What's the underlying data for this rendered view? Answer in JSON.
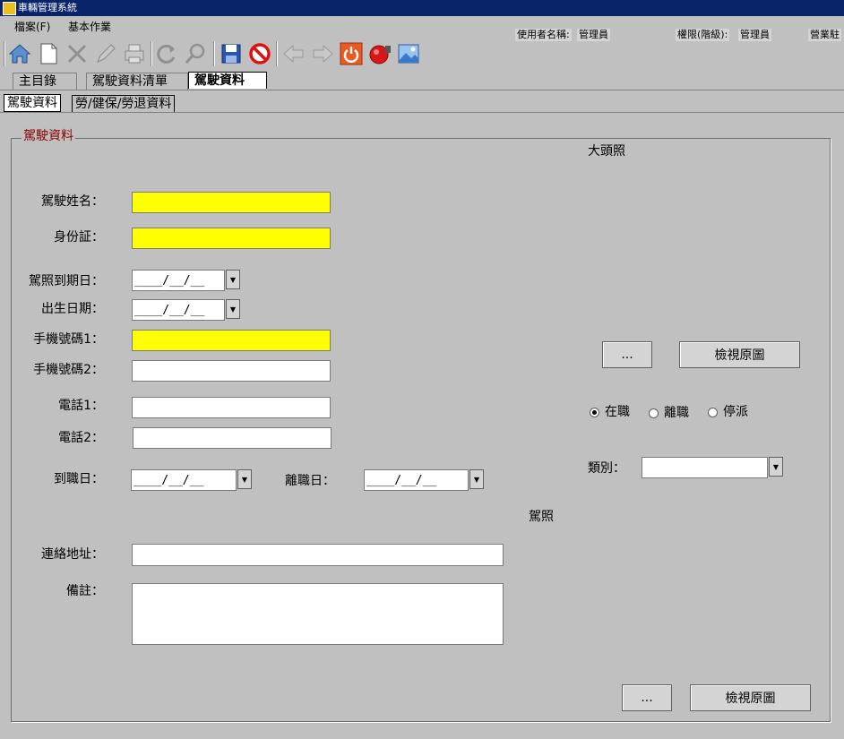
{
  "window": {
    "title": "車輛管理系統"
  },
  "menu": {
    "file": "檔案(F)",
    "basic": "基本作業"
  },
  "userinfo": {
    "user_label": "使用者名稱:",
    "user_value": "管理員",
    "role_label": "權限(階級):",
    "role_value": "管理員",
    "office_label": "營業駐"
  },
  "toolbar": {
    "icons": [
      "home-icon",
      "new-icon",
      "delete-icon",
      "edit-icon",
      "print-icon",
      "refresh-icon",
      "search-icon",
      "save-icon",
      "cancel-icon",
      "prev-icon",
      "next-icon",
      "power-icon",
      "alarm-icon",
      "image-icon"
    ]
  },
  "tabs": [
    {
      "label": "主目錄"
    },
    {
      "label": "駕駛資料清單"
    },
    {
      "label": "駕駛資料"
    }
  ],
  "subtabs": [
    {
      "label": "駕駛資料"
    },
    {
      "label": "勞/健保/勞退資料"
    }
  ],
  "form": {
    "group_title": "駕駛資料",
    "photo_label": "大頭照",
    "license_label": "駕照",
    "name_label": "駕駛姓名：",
    "id_label": "身份証：",
    "license_expiry_label": "駕照到期日：",
    "birth_label": "出生日期：",
    "mobile1_label": "手機號碼1：",
    "mobile2_label": "手機號碼2：",
    "phone1_label": "電話1：",
    "phone2_label": "電話2：",
    "join_label": "到職日：",
    "leave_label": "離職日：",
    "address_label": "連絡地址：",
    "note_label": "備註：",
    "date_mask": "____/__/__",
    "name_value": "",
    "id_value": "",
    "mobile1_value": "",
    "mobile2_value": "",
    "phone1_value": "",
    "phone2_value": "",
    "address_value": "",
    "note_value": "",
    "category_label": "類別：",
    "category_value": "",
    "browse_label": "...",
    "view_original_label": "檢視原圖",
    "status": {
      "options": [
        "在職",
        "離職",
        "停派"
      ],
      "selected": "在職"
    }
  }
}
